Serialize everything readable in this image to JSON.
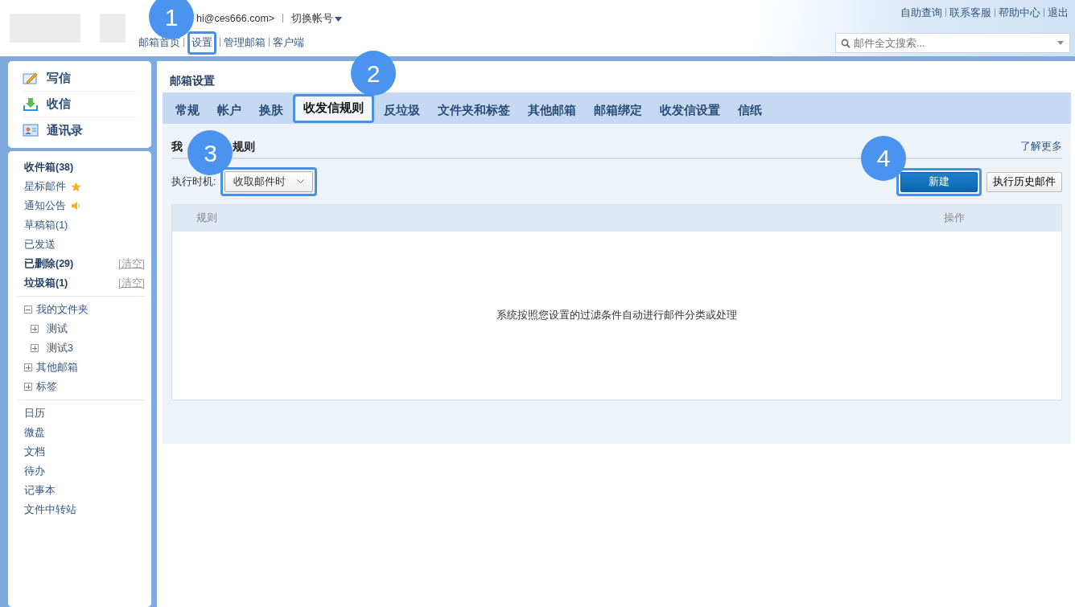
{
  "header": {
    "account": "hi@ces666.com>",
    "switch_account": "切换帐号",
    "links": [
      {
        "label": "邮箱首页"
      },
      {
        "label": "设置",
        "callout": "1"
      },
      {
        "label": "管理邮箱"
      },
      {
        "label": "客户端"
      }
    ],
    "top_links": [
      "自助查询",
      "联系客服",
      "帮助中心",
      "退出"
    ],
    "search": {
      "placeholder": "邮件全文搜索..."
    }
  },
  "sidebar": {
    "quick": [
      {
        "label": "写信",
        "kind": "compose"
      },
      {
        "label": "收信",
        "kind": "receive"
      },
      {
        "label": "通讯录",
        "kind": "contacts"
      }
    ],
    "folders": [
      {
        "label": "收件箱(38)",
        "bold": true,
        "kind": "plain"
      },
      {
        "label": "星标邮件",
        "bold": false,
        "kind": "starred"
      },
      {
        "label": "通知公告",
        "bold": false,
        "kind": "notice"
      },
      {
        "label": "草稿箱(1)",
        "bold": false,
        "kind": "plain"
      },
      {
        "label": "已发送",
        "bold": false,
        "kind": "plain"
      },
      {
        "label": "已删除(29)",
        "bold": true,
        "kind": "plain",
        "action": "[清空]"
      },
      {
        "label": "垃圾箱(1)",
        "bold": true,
        "kind": "plain",
        "action": "[清空]"
      }
    ],
    "tree": [
      {
        "label": "我的文件夹",
        "expanded": true,
        "children": [
          {
            "label": "测试",
            "expanded": false
          },
          {
            "label": "测试3",
            "expanded": false
          }
        ]
      },
      {
        "label": "其他邮箱",
        "expanded": false
      },
      {
        "label": "标签",
        "expanded": false
      }
    ],
    "apps": [
      "日历",
      "微盘",
      "文档",
      "待办",
      "记事本",
      "文件中转站"
    ]
  },
  "main": {
    "title": "邮箱设置",
    "tabs": [
      {
        "label": "常规",
        "selected": false
      },
      {
        "label": "帐户",
        "selected": false
      },
      {
        "label": "换肤",
        "selected": false
      },
      {
        "label": "收发信规则",
        "selected": true,
        "callout": "2"
      },
      {
        "label": "反垃圾",
        "selected": false
      },
      {
        "label": "文件夹和标签",
        "selected": false
      },
      {
        "label": "其他邮箱",
        "selected": false
      },
      {
        "label": "邮箱绑定",
        "selected": false
      },
      {
        "label": "收发信设置",
        "selected": false
      },
      {
        "label": "信纸",
        "selected": false
      }
    ],
    "section_title": [
      "我",
      "规则"
    ],
    "learn_more": "了解更多",
    "timing_label": "执行时机:",
    "timing_select": {
      "value": "收取邮件时",
      "callout": "3"
    },
    "new_button": {
      "label": "新建",
      "callout": "4"
    },
    "history_button": "执行历史邮件",
    "table": {
      "columns": [
        "规则",
        "操作"
      ],
      "empty_text": "系统按照您设置的过滤条件自动进行邮件分类或处理"
    }
  }
}
